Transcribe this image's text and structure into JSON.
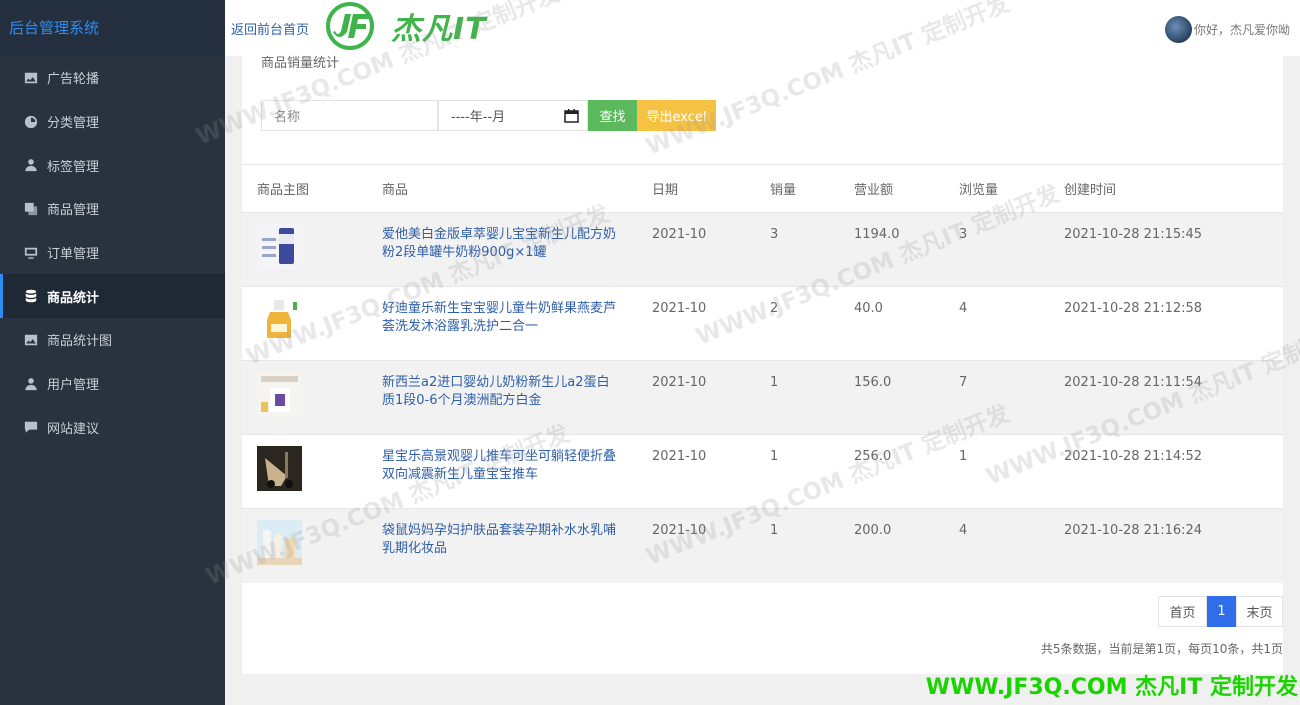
{
  "sidebar": {
    "brand": "后台管理系统",
    "items": [
      {
        "label": "广告轮播",
        "icon": "image-icon"
      },
      {
        "label": "分类管理",
        "icon": "dashboard-icon"
      },
      {
        "label": "标签管理",
        "icon": "user-tie-icon"
      },
      {
        "label": "商品管理",
        "icon": "clone-icon"
      },
      {
        "label": "订单管理",
        "icon": "monitor-icon"
      },
      {
        "label": "商品统计",
        "icon": "database-icon",
        "active": true
      },
      {
        "label": "商品统计图",
        "icon": "image-icon"
      },
      {
        "label": "用户管理",
        "icon": "user-icon"
      },
      {
        "label": "网站建议",
        "icon": "comment-icon"
      }
    ]
  },
  "header": {
    "back_link": "返回前台首页",
    "logo_text": "杰凡IT",
    "greeting": "你好，杰凡爱你呦"
  },
  "panel": {
    "title": "商品销量统计",
    "search_placeholder": "名称",
    "date_placeholder": "----年--月",
    "search_btn": "查找",
    "export_btn": "导出excel"
  },
  "table": {
    "headers": [
      "商品主图",
      "商品",
      "日期",
      "销量",
      "营业额",
      "浏览量",
      "创建时间"
    ],
    "rows": [
      {
        "name": "爱他美白金版卓萃婴儿宝宝新生儿配方奶粉2段单罐牛奶粉900g×1罐",
        "date": "2021-10",
        "sales": "3",
        "revenue": "1194.0",
        "views": "3",
        "created": "2021-10-28 21:15:45"
      },
      {
        "name": "好迪童乐新生宝宝婴儿童牛奶鲜果燕麦芦荟洗发沐浴露乳洗护二合一",
        "date": "2021-10",
        "sales": "2",
        "revenue": "40.0",
        "views": "4",
        "created": "2021-10-28 21:12:58"
      },
      {
        "name": "新西兰a2进口婴幼儿奶粉新生儿a2蛋白质1段0-6个月澳洲配方白金",
        "date": "2021-10",
        "sales": "1",
        "revenue": "156.0",
        "views": "7",
        "created": "2021-10-28 21:11:54"
      },
      {
        "name": "星宝乐高景观婴儿推车可坐可躺轻便折叠双向减震新生儿童宝宝推车",
        "date": "2021-10",
        "sales": "1",
        "revenue": "256.0",
        "views": "1",
        "created": "2021-10-28 21:14:52"
      },
      {
        "name": "袋鼠妈妈孕妇护肤品套装孕期补水水乳哺乳期化妆品",
        "date": "2021-10",
        "sales": "1",
        "revenue": "200.0",
        "views": "4",
        "created": "2021-10-28 21:16:24"
      }
    ]
  },
  "pagination": {
    "first": "首页",
    "current": "1",
    "last": "末页",
    "summary": "共5条数据，当前是第1页，每页10条，共1页"
  },
  "watermark": {
    "text": "WWW.JF3Q.COM 杰凡IT 定制开发",
    "footer": "WWW.JF3Q.COM 杰凡IT  定制开发"
  },
  "colors": {
    "sidebar_bg": "#28333f",
    "accent_blue": "#2f8cf0",
    "search_green": "#5cb85c",
    "export_yellow": "#f6c243",
    "page_active": "#2f6ee8",
    "footer_watermark": "#1bd300"
  }
}
